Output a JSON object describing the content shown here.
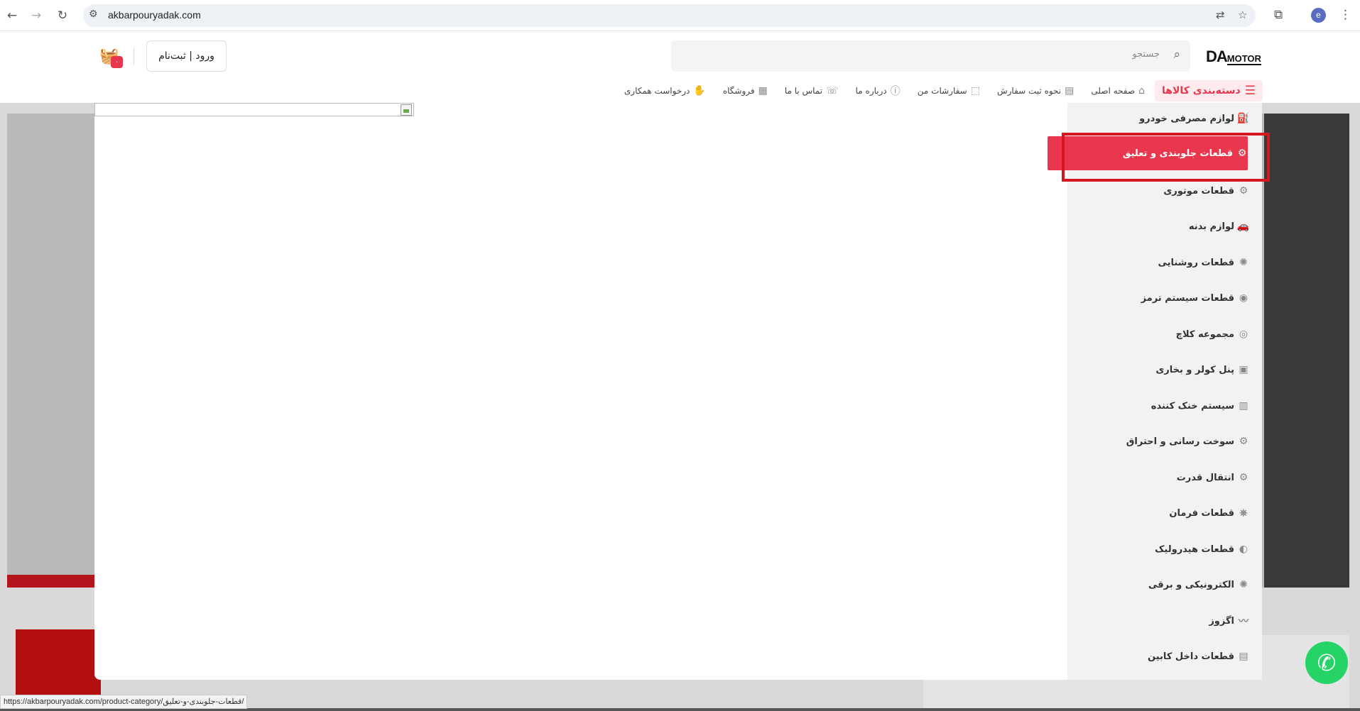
{
  "browser": {
    "url": "akbarpouryadak.com",
    "profile_initial": "e",
    "status_url": "https://akbarpouryadak.com/product-category/قطعات-جلوبندی-و-تعلیق/"
  },
  "header": {
    "logo_da": "DA",
    "logo_motor": "MOTOR",
    "search_placeholder": "جستجو",
    "login_label": "ورود | ثبت‌نام",
    "cart_count": "۰"
  },
  "nav": {
    "category_label": "دسته‌بندی کالاها",
    "items": [
      {
        "label": "صفحه اصلی",
        "icon": "home-icon"
      },
      {
        "label": "نحوه ثبت سفارش",
        "icon": "receipt-icon"
      },
      {
        "label": "سفارشات من",
        "icon": "box-icon"
      },
      {
        "label": "درباره ما",
        "icon": "info-icon"
      },
      {
        "label": "تماس با ما",
        "icon": "phone-icon"
      },
      {
        "label": "فروشگاه",
        "icon": "store-icon"
      },
      {
        "label": "درخواست همکاری",
        "icon": "handshake-icon"
      }
    ]
  },
  "categories": [
    {
      "label": "لوازم مصرفی خودرو",
      "icon": "oil-icon"
    },
    {
      "label": "قطعات جلوبندی و تعلیق",
      "icon": "suspension-icon"
    },
    {
      "label": "قطعات موتوری",
      "icon": "engine-icon"
    },
    {
      "label": "لوازم بدنه",
      "icon": "car-body-icon"
    },
    {
      "label": "قطعات روشنایی",
      "icon": "light-icon"
    },
    {
      "label": "قطعات سیستم ترمز",
      "icon": "brake-icon"
    },
    {
      "label": "مجموعه کلاچ",
      "icon": "clutch-icon"
    },
    {
      "label": "پنل کولر و بخاری",
      "icon": "ac-panel-icon"
    },
    {
      "label": "سیستم خنک کننده",
      "icon": "radiator-icon"
    },
    {
      "label": "سوخت رسانی و احتراق",
      "icon": "fuel-icon"
    },
    {
      "label": "انتقال قدرت",
      "icon": "gear-icon"
    },
    {
      "label": "قطعات فرمان",
      "icon": "steering-icon"
    },
    {
      "label": "قطعات هیدرولیک",
      "icon": "hydraulic-icon"
    },
    {
      "label": "الکترونیکی و برقی",
      "icon": "electric-icon"
    },
    {
      "label": "اگزوز",
      "icon": "exhaust-icon"
    },
    {
      "label": "قطعات داخل کابین",
      "icon": "seat-icon"
    }
  ],
  "active_category_index": 1
}
